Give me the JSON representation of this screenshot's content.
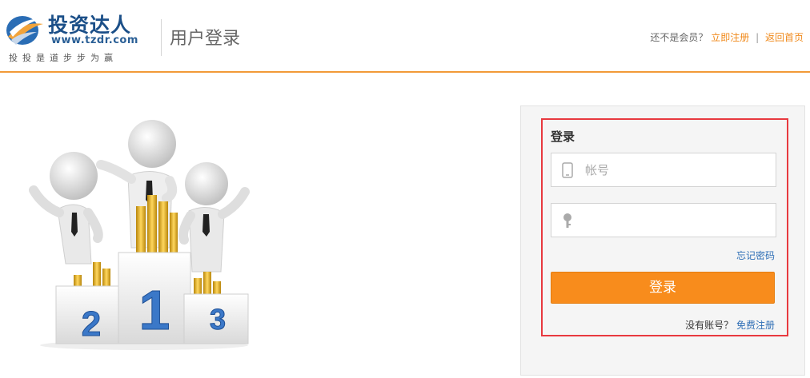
{
  "header": {
    "logo_title": "投资达人",
    "logo_url": "www.tzdr.com",
    "logo_slogan": "投投是道步步为赢",
    "page_title": "用户登录",
    "not_member_text": "还不是会员？",
    "register_now_link": "立即注册",
    "separator": "|",
    "back_home_link": "返回首页"
  },
  "illustration": {
    "podium_numbers": [
      "2",
      "1",
      "3"
    ]
  },
  "login": {
    "heading": "登录",
    "account_placeholder": "帐号",
    "password_placeholder": "",
    "forgot_password": "忘记密码",
    "submit_label": "登录",
    "no_account_text": "没有账号？",
    "free_register_link": "免费注册"
  },
  "colors": {
    "accent_orange": "#f88c1c",
    "link_blue": "#2f6fb6",
    "highlight_red": "#e8393f"
  },
  "icons": {
    "phone": "phone-icon",
    "key": "key-icon",
    "logo": "logo-swirl-icon"
  }
}
